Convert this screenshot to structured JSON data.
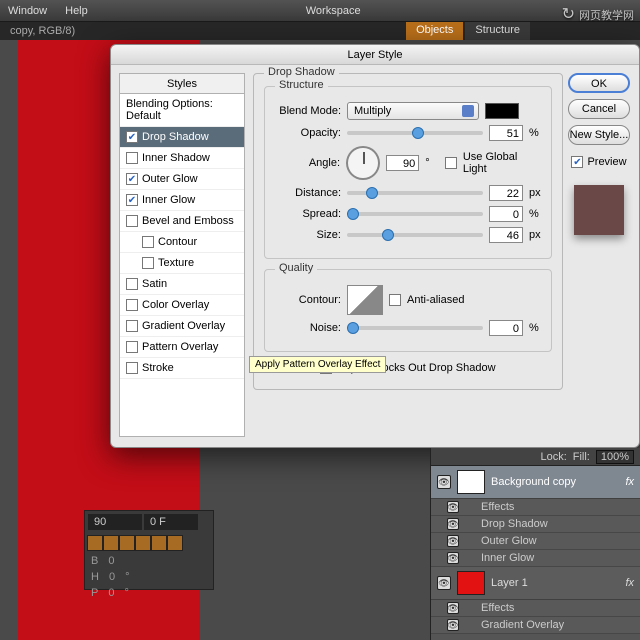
{
  "menubar": {
    "items": [
      "Window",
      "Help"
    ],
    "workspace": "Workspace"
  },
  "doc_tab": "copy, RGB/8)",
  "panel_tabs": {
    "objects": "Objects",
    "structure": "Structure"
  },
  "watermark": "网页教学网",
  "dialog": {
    "title": "Layer Style",
    "styles_header": "Styles",
    "blending_options": "Blending Options: Default",
    "styles": [
      {
        "label": "Drop Shadow",
        "checked": true,
        "selected": true
      },
      {
        "label": "Inner Shadow",
        "checked": false
      },
      {
        "label": "Outer Glow",
        "checked": true
      },
      {
        "label": "Inner Glow",
        "checked": true
      },
      {
        "label": "Bevel and Emboss",
        "checked": false
      },
      {
        "label": "Contour",
        "checked": false,
        "sub": true
      },
      {
        "label": "Texture",
        "checked": false,
        "sub": true
      },
      {
        "label": "Satin",
        "checked": false
      },
      {
        "label": "Color Overlay",
        "checked": false
      },
      {
        "label": "Gradient Overlay",
        "checked": false
      },
      {
        "label": "Pattern Overlay",
        "checked": false
      },
      {
        "label": "Stroke",
        "checked": false
      }
    ],
    "main_group": "Drop Shadow",
    "structure_group": "Structure",
    "blend_mode": {
      "label": "Blend Mode:",
      "value": "Multiply"
    },
    "opacity": {
      "label": "Opacity:",
      "value": "51",
      "unit": "%"
    },
    "angle": {
      "label": "Angle:",
      "value": "90",
      "unit": "°",
      "global": "Use Global Light",
      "global_checked": false
    },
    "distance": {
      "label": "Distance:",
      "value": "22",
      "unit": "px"
    },
    "spread": {
      "label": "Spread:",
      "value": "0",
      "unit": "%"
    },
    "size": {
      "label": "Size:",
      "value": "46",
      "unit": "px"
    },
    "quality_group": "Quality",
    "contour": {
      "label": "Contour:",
      "anti": "Anti-aliased",
      "anti_checked": false
    },
    "noise": {
      "label": "Noise:",
      "value": "0",
      "unit": "%"
    },
    "knockout": {
      "label": "Layer Knocks Out Drop Shadow",
      "checked": true
    },
    "buttons": {
      "ok": "OK",
      "cancel": "Cancel",
      "new_style": "New Style..."
    },
    "preview": {
      "label": "Preview",
      "checked": true
    },
    "tooltip": "Apply Pattern Overlay Effect"
  },
  "layers": {
    "fill_label": "Fill:",
    "fill_value": "100%",
    "lock_label": "Lock:",
    "items": [
      {
        "name": "Background copy",
        "selected": true,
        "thumb": "white",
        "fx": "fx",
        "effects_label": "Effects",
        "effects": [
          "Drop Shadow",
          "Outer Glow",
          "Inner Glow"
        ]
      },
      {
        "name": "Layer 1",
        "thumb": "red",
        "fx": "fx",
        "effects_label": "Effects",
        "effects": [
          "Gradient Overlay"
        ]
      }
    ]
  },
  "bottom": {
    "v1": "90",
    "v2": "0 F",
    "b": "B",
    "h": "H",
    "p": "P",
    "zero": "0",
    "deg": "°"
  }
}
